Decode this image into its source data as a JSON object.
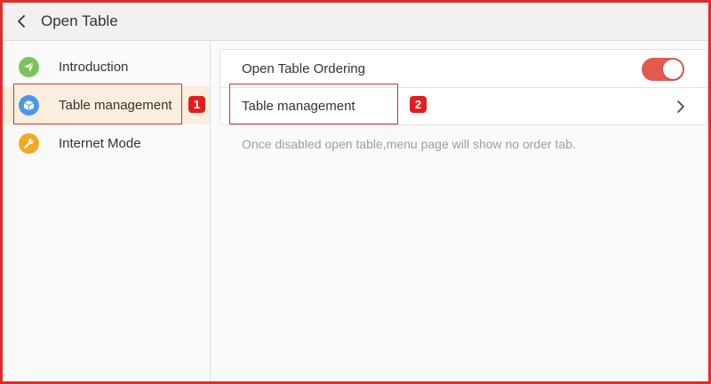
{
  "header": {
    "title": "Open Table",
    "back_icon": "chevron-left-icon"
  },
  "sidebar": {
    "items": [
      {
        "label": "Introduction",
        "icon": "paper-plane-icon",
        "icon_color": "#7cc35e",
        "active": false
      },
      {
        "label": "Table management",
        "icon": "cube-icon",
        "icon_color": "#4a98e8",
        "active": true
      },
      {
        "label": "Internet Mode",
        "icon": "wrench-icon",
        "icon_color": "#f5a623",
        "active": false
      }
    ]
  },
  "main": {
    "rows": [
      {
        "label": "Open Table Ordering",
        "control": "toggle",
        "toggle_on": true
      },
      {
        "label": "Table management",
        "control": "chevron-right-icon"
      }
    ],
    "hint": "Once disabled open table,menu page will show no order tab."
  },
  "annotations": {
    "badge_1": "1",
    "badge_2": "2"
  },
  "colors": {
    "annotation_red": "#e32b2b",
    "toggle_on": "#e45a4f",
    "active_bg": "#fbeedd"
  }
}
